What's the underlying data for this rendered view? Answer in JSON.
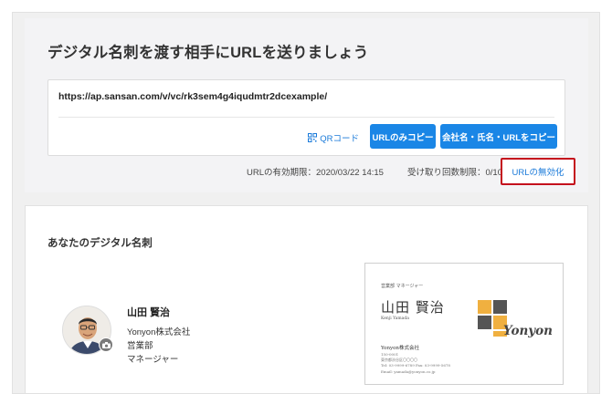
{
  "share": {
    "title": "デジタル名刺を渡す相手にURLを送りましょう",
    "url": "https://ap.sansan.com/v/vc/rk3sem4g4iqudmtr2dcexample/",
    "qr_label": "QRコード",
    "copy_url_label": "URLのみコピー",
    "copy_all_label": "会社名・氏名・URLをコピー",
    "expiry": "URLの有効期限：2020/03/22 14:15",
    "receive_limit": "受け取り回数制限：0/10",
    "disable_label": "URLの無効化"
  },
  "card": {
    "section_title": "あなたのデジタル名刺",
    "name": "山田 賢治",
    "company": "Yonyon株式会社",
    "department": "営業部",
    "position": "マネージャー"
  },
  "bizcard": {
    "role": "営業部 マネージャー",
    "name": "山田 賢治",
    "roman": "Kenji Yamada",
    "company": "Yonyon株式会社",
    "zip": "150-0001",
    "address": "東京都渋谷区〇〇〇〇",
    "tel": "Tel: 03-9999-6789   Fax: 03-9999-5678",
    "email": "Email: yamada@yonyon.co.jp",
    "logo_text": "Yonyon"
  },
  "colors": {
    "accent_blue": "#1a86e6",
    "link_blue": "#1a7ad9",
    "highlight_red": "#c4101d",
    "logo_orange": "#f0b040",
    "logo_gray": "#555555"
  }
}
